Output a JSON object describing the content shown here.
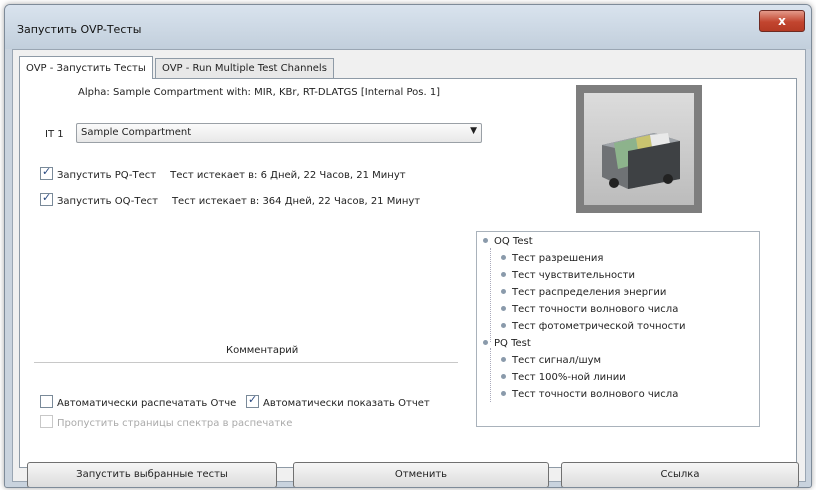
{
  "window": {
    "title": "Запустить OVP-Тесты",
    "close_label": "x"
  },
  "tabs": [
    {
      "label": "OVP - Запустить Тесты"
    },
    {
      "label": "OVP - Run Multiple Test Channels"
    }
  ],
  "panel": {
    "alpha_text": "Alpha: Sample Compartment with: MIR, KBr, RT-DLATGS [Internal Pos. 1]",
    "it_label": "IT 1",
    "select_value": "Sample Compartment",
    "pq": {
      "label": "Запустить PQ-Тест",
      "checked": true,
      "expires": "Тест истекает в: 6 Дней, 22 Часов, 21 Минут"
    },
    "oq": {
      "label": "Запустить OQ-Тест",
      "checked": true,
      "expires": "Тест истекает в: 364 Дней, 22 Часов, 21 Минут"
    },
    "comment_label": "Комментарий",
    "auto_print": {
      "label": "Автоматически распечатать Отче",
      "checked": false
    },
    "auto_show": {
      "label": "Автоматически показать Отчет",
      "checked": true
    },
    "skip_pages": {
      "label": "Пропустить страницы спектра в распечатке",
      "checked": false
    }
  },
  "tree": {
    "oq_title": "OQ Test",
    "oq_items": [
      "Тест разрешения",
      "Тест чувствительности",
      "Тест распределения энергии",
      "Тест точности волнового числа",
      "Тест фотометрической точности"
    ],
    "pq_title": "PQ Test",
    "pq_items": [
      "Тест сигнал/шум",
      "Тест 100%-ной линии",
      "Тест точности волнового числа"
    ]
  },
  "buttons": {
    "run": "Запустить выбранные тесты",
    "cancel": "Отменить",
    "help": "Ссылка"
  },
  "icons": {
    "close": "close-icon",
    "dropdown": "chevron-down-icon",
    "image": "sample-compartment-icon"
  }
}
